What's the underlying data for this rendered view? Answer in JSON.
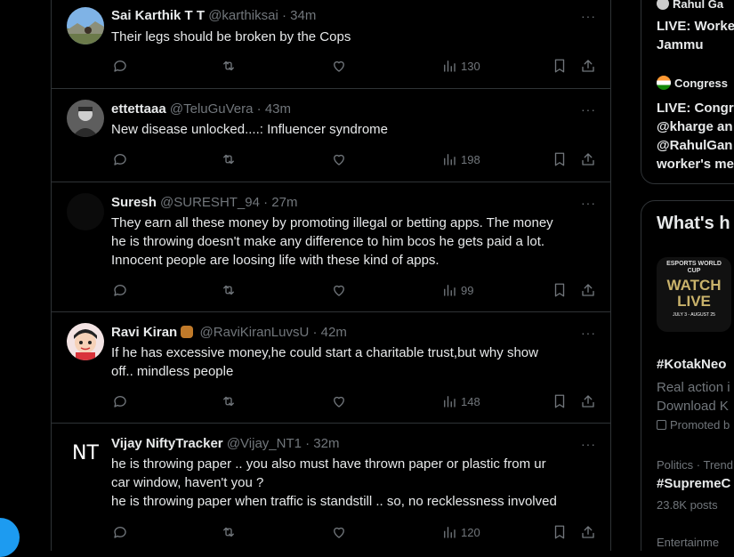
{
  "tweets": [
    {
      "name": "Sai Karthik T T",
      "handle": "@karthiksai",
      "time": "· 34m",
      "text": [
        "Their legs should be broken by the Cops"
      ],
      "views": "130",
      "avatar": "photo-landscape"
    },
    {
      "name": "ettettaaa",
      "handle": "@TeluGuVera",
      "time": "· 43m",
      "text": [
        "New disease unlocked....: Influencer syndrome"
      ],
      "views": "198",
      "avatar": "photo-person"
    },
    {
      "name": "Suresh",
      "handle": "@SURESHT_94",
      "time": "· 27m",
      "text": [
        "They earn all these money by promoting illegal or betting apps. The money",
        "he is throwing doesn't make any difference to him bcos he gets paid a lot.",
        "Innocent people are loosing life with these kind of apps."
      ],
      "views": "99",
      "avatar": "dark"
    },
    {
      "name": "Ravi Kiran",
      "handle": "@RaviKiranLuvsU",
      "time": "· 42m",
      "text": [
        "If he has excessive money,he could start a charitable trust,but why show",
        "off.. mindless people"
      ],
      "views": "148",
      "avatar": "cartoon"
    },
    {
      "name": "Vijay NiftyTracker",
      "handle": "@Vijay_NT1",
      "time": "· 32m",
      "text": [
        "he is throwing paper .. you also must have thrown paper or plastic from ur",
        "car window, haven't you ?",
        "he is throwing paper when traffic is standstill .. so, no recklessness involved"
      ],
      "views": "120",
      "avatar_text": "NT"
    }
  ],
  "more_glyph": "···",
  "sidebar": {
    "top_partial": "Rahul Ga",
    "live1": [
      "LIVE: Worke",
      "Jammu"
    ],
    "congress": "Congress",
    "live2": [
      "LIVE: Congr",
      "@kharge an",
      "@RahulGan",
      "worker's me"
    ],
    "whats_happening": "What's h",
    "promo_image_text": {
      "brand": "ESPORTS WORLD CUP",
      "watch": "WATCH",
      "live": "LIVE",
      "dates": "JULY 3 - AUGUST 25"
    },
    "hashtag1": "#KotakNeo",
    "desc1": [
      "Real action i",
      "Download K"
    ],
    "promoted": "Promoted b",
    "category2": "Politics · Trend",
    "hashtag2": "#SupremeC",
    "posts2": "23.8K posts",
    "category3": "Entertainme"
  },
  "colors": {
    "accent": "#1d9bf0",
    "text": "#e7e9ea",
    "muted": "#71767b",
    "border": "#2f3336"
  }
}
